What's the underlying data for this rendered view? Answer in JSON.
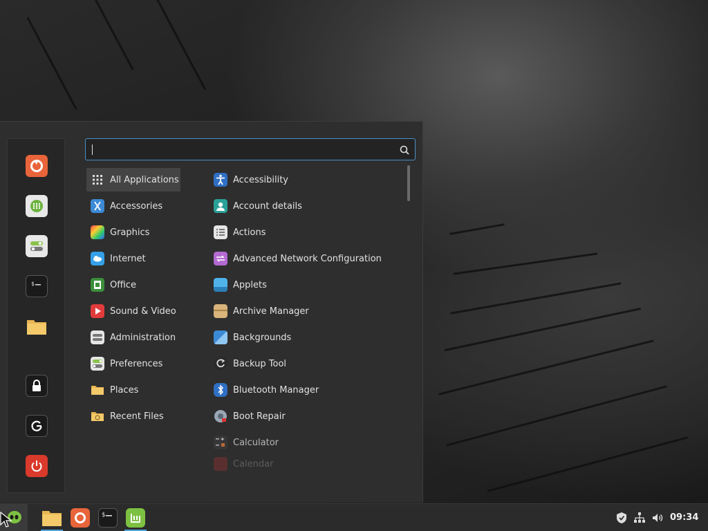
{
  "search": {
    "placeholder": "",
    "value": ""
  },
  "favorites": [
    {
      "icon": "firefox-icon",
      "label": "Firefox"
    },
    {
      "icon": "software-manager-icon",
      "label": "Software Manager"
    },
    {
      "icon": "system-settings-icon",
      "label": "System Settings"
    },
    {
      "icon": "terminal-icon",
      "label": "Terminal"
    },
    {
      "icon": "files-icon",
      "label": "Files"
    }
  ],
  "session": [
    {
      "icon": "lock-icon",
      "label": "Lock Screen"
    },
    {
      "icon": "logout-icon",
      "label": "Logout"
    },
    {
      "icon": "power-icon",
      "label": "Quit"
    }
  ],
  "categories": [
    {
      "label": "All Applications",
      "icon": "grid-icon",
      "active": true
    },
    {
      "label": "Accessories",
      "icon": "accessories-icon"
    },
    {
      "label": "Graphics",
      "icon": "graphics-icon"
    },
    {
      "label": "Internet",
      "icon": "internet-icon"
    },
    {
      "label": "Office",
      "icon": "office-icon"
    },
    {
      "label": "Sound & Video",
      "icon": "sound-video-icon"
    },
    {
      "label": "Administration",
      "icon": "administration-icon"
    },
    {
      "label": "Preferences",
      "icon": "preferences-icon"
    },
    {
      "label": "Places",
      "icon": "places-icon"
    },
    {
      "label": "Recent Files",
      "icon": "recent-files-icon"
    }
  ],
  "apps": [
    {
      "label": "Accessibility",
      "icon": "accessibility-icon"
    },
    {
      "label": "Account details",
      "icon": "account-icon"
    },
    {
      "label": "Actions",
      "icon": "actions-icon"
    },
    {
      "label": "Advanced Network Configuration",
      "icon": "network-config-icon"
    },
    {
      "label": "Applets",
      "icon": "applets-icon"
    },
    {
      "label": "Archive Manager",
      "icon": "archive-icon"
    },
    {
      "label": "Backgrounds",
      "icon": "backgrounds-icon"
    },
    {
      "label": "Backup Tool",
      "icon": "backup-icon"
    },
    {
      "label": "Bluetooth Manager",
      "icon": "bluetooth-icon"
    },
    {
      "label": "Boot Repair",
      "icon": "boot-repair-icon"
    },
    {
      "label": "Calculator",
      "icon": "calculator-icon"
    },
    {
      "label": "Calendar",
      "icon": "calendar-icon"
    }
  ],
  "taskbar": {
    "menu_icon": "mint-menu-icon",
    "launchers": [
      {
        "icon": "files-icon",
        "label": "Files",
        "running": true
      },
      {
        "icon": "firefox-icon",
        "label": "Firefox",
        "running": false
      },
      {
        "icon": "terminal-icon",
        "label": "Terminal",
        "running": false
      },
      {
        "icon": "mintupdate-icon",
        "label": "Update Manager",
        "running": true
      }
    ],
    "tray": [
      "shield-icon",
      "network-icon",
      "volume-icon"
    ],
    "clock": "09:34"
  },
  "colors": {
    "accent": "#4a90c8",
    "menu_bg": "#2e2e2e",
    "panel_bg": "#2b2b2b",
    "selection": "#444444"
  }
}
